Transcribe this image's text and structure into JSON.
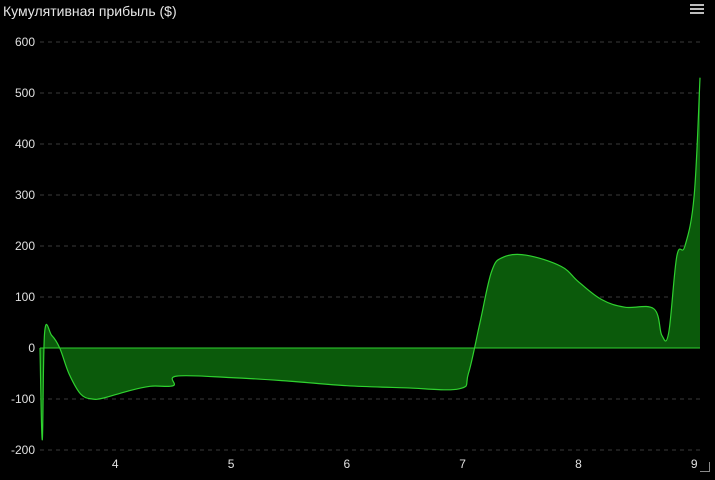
{
  "header": {
    "title": "Кумулятивная прибыль ($)"
  },
  "colors": {
    "background": "#000000",
    "line": "#2fd12f",
    "fill": "#0b5a0b",
    "grid": "#3a3a3a",
    "text": "#e0e0e0"
  },
  "chart_data": {
    "type": "area",
    "title": "Кумулятивная прибыль ($)",
    "xlabel": "",
    "ylabel": "",
    "xlim": [
      3.35,
      9.05
    ],
    "ylim": [
      -200,
      600
    ],
    "grid": true,
    "legend": "none",
    "x_ticks": [
      4,
      5,
      6,
      7,
      8,
      9
    ],
    "y_ticks": [
      -200,
      -100,
      0,
      100,
      200,
      300,
      400,
      500,
      600
    ],
    "series": [
      {
        "values": [
          {
            "x": 3.35,
            "y": 0
          },
          {
            "x": 3.37,
            "y": -180
          },
          {
            "x": 3.39,
            "y": 30
          },
          {
            "x": 3.45,
            "y": 25
          },
          {
            "x": 3.52,
            "y": 0
          },
          {
            "x": 3.6,
            "y": -50
          },
          {
            "x": 3.7,
            "y": -90
          },
          {
            "x": 3.8,
            "y": -100
          },
          {
            "x": 3.9,
            "y": -98
          },
          {
            "x": 4.1,
            "y": -85
          },
          {
            "x": 4.3,
            "y": -75
          },
          {
            "x": 4.5,
            "y": -74
          },
          {
            "x": 4.53,
            "y": -55
          },
          {
            "x": 5.0,
            "y": -58
          },
          {
            "x": 5.5,
            "y": -65
          },
          {
            "x": 6.0,
            "y": -74
          },
          {
            "x": 6.5,
            "y": -78
          },
          {
            "x": 6.97,
            "y": -80
          },
          {
            "x": 7.05,
            "y": -50
          },
          {
            "x": 7.15,
            "y": 50
          },
          {
            "x": 7.25,
            "y": 150
          },
          {
            "x": 7.35,
            "y": 178
          },
          {
            "x": 7.55,
            "y": 182
          },
          {
            "x": 7.85,
            "y": 160
          },
          {
            "x": 8.0,
            "y": 130
          },
          {
            "x": 8.2,
            "y": 95
          },
          {
            "x": 8.4,
            "y": 80
          },
          {
            "x": 8.65,
            "y": 77
          },
          {
            "x": 8.72,
            "y": 25
          },
          {
            "x": 8.78,
            "y": 30
          },
          {
            "x": 8.85,
            "y": 180
          },
          {
            "x": 8.92,
            "y": 200
          },
          {
            "x": 9.0,
            "y": 300
          },
          {
            "x": 9.05,
            "y": 530
          }
        ]
      }
    ]
  }
}
